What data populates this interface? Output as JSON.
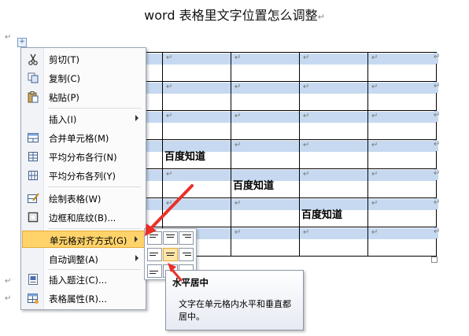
{
  "page_title": "word 表格里文字位置怎么调整",
  "return_mark": "↵",
  "table_cell_text": "百度知道",
  "table_handle": "+",
  "context_menu": {
    "items": [
      {
        "label": "剪切(T)",
        "icon": "scissors-icon"
      },
      {
        "label": "复制(C)",
        "icon": "copy-icon"
      },
      {
        "label": "粘贴(P)",
        "icon": "paste-icon"
      },
      {
        "label": "插入(I)",
        "icon": "",
        "submenu": true
      },
      {
        "label": "合并单元格(M)",
        "icon": "merge-cells-icon"
      },
      {
        "label": "平均分布各行(N)",
        "icon": "distribute-rows-icon"
      },
      {
        "label": "平均分布各列(Y)",
        "icon": "distribute-columns-icon"
      },
      {
        "label": "绘制表格(W)",
        "icon": "draw-table-icon"
      },
      {
        "label": "边框和底纹(B)...",
        "icon": "borders-icon"
      },
      {
        "label": "单元格对齐方式(G)",
        "icon": "",
        "submenu": true,
        "highlighted": true
      },
      {
        "label": "自动调整(A)",
        "icon": "",
        "submenu": true
      },
      {
        "label": "插入题注(C)...",
        "icon": "insert-caption-icon"
      },
      {
        "label": "表格属性(R)...",
        "icon": "table-properties-icon"
      }
    ]
  },
  "tooltip": {
    "title": "水平居中",
    "description": "文字在单元格内水平和垂直都居中。"
  },
  "colors": {
    "highlight": "#ffd36a",
    "cell_band": "#c6d9f1",
    "arrow": "#e8312a"
  }
}
